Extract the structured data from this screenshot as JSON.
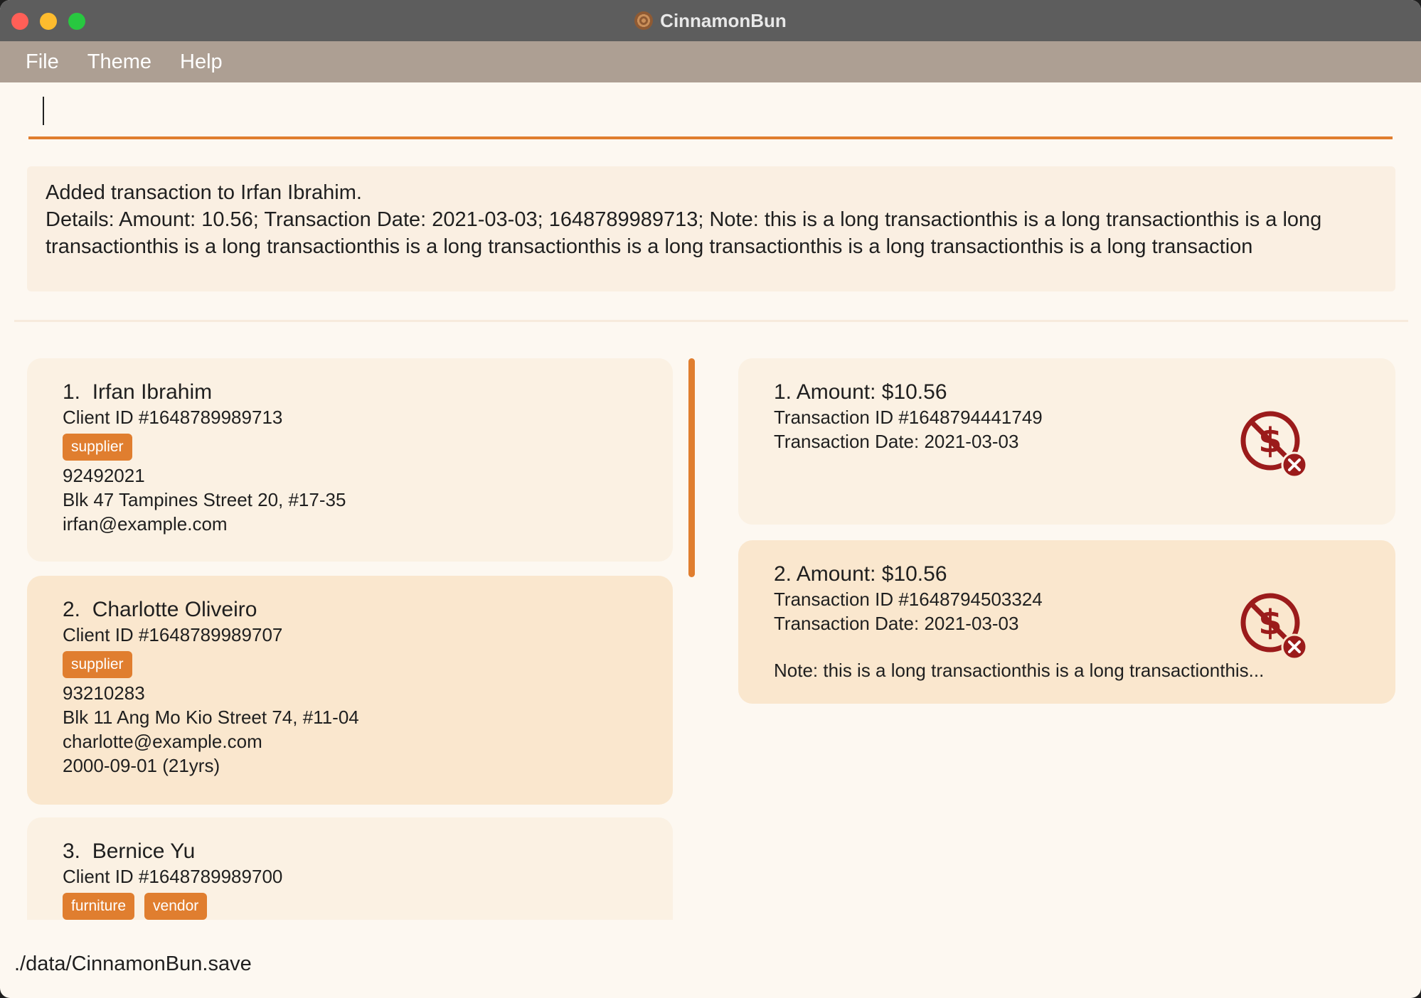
{
  "window": {
    "title": "CinnamonBun"
  },
  "menu": {
    "file": "File",
    "theme": "Theme",
    "help": "Help"
  },
  "command": {
    "value": "",
    "placeholder": ""
  },
  "result": {
    "text": "Added transaction to Irfan Ibrahim.\nDetails: Amount: 10.56; Transaction Date: 2021-03-03; 1648789989713; Note: this is a long transactionthis is a long transactionthis is a long transactionthis is a long transactionthis is a long transactionthis is a long transactionthis is a long transactionthis is a long transaction"
  },
  "clients": [
    {
      "index": "1.",
      "name": "Irfan Ibrahim",
      "client_id": "Client ID #1648789989713",
      "tags": [
        "supplier"
      ],
      "phone": "92492021",
      "address": "Blk 47 Tampines Street 20, #17-35",
      "email": "irfan@example.com",
      "birthday": ""
    },
    {
      "index": "2.",
      "name": "Charlotte Oliveiro",
      "client_id": "Client ID #1648789989707",
      "tags": [
        "supplier"
      ],
      "phone": "93210283",
      "address": "Blk 11 Ang Mo Kio Street 74, #11-04",
      "email": "charlotte@example.com",
      "birthday": "2000-09-01 (21yrs)"
    },
    {
      "index": "3.",
      "name": "Bernice Yu",
      "client_id": "Client ID #1648789989700",
      "tags": [
        "furniture",
        "vendor"
      ]
    }
  ],
  "transactions": [
    {
      "title": "1. Amount: $10.56",
      "transaction_id": "Transaction ID #1648794441749",
      "transaction_date": "Transaction Date: 2021-03-03",
      "note": "",
      "status_icon": "unpaid-icon",
      "status_color": "#9b1b1b"
    },
    {
      "title": "2. Amount: $10.56",
      "transaction_id": "Transaction ID #1648794503324",
      "transaction_date": "Transaction Date: 2021-03-03",
      "note": "Note: this is a long transactionthis is a long transactionthis...",
      "status_icon": "unpaid-icon",
      "status_color": "#9b1b1b"
    }
  ],
  "status": {
    "save_path": "./data/CinnamonBun.save"
  },
  "colors": {
    "accent": "#e07e2f",
    "menubar": "#ad9f93",
    "titlebar": "#5d5d5d",
    "background": "#fdf8f1"
  }
}
